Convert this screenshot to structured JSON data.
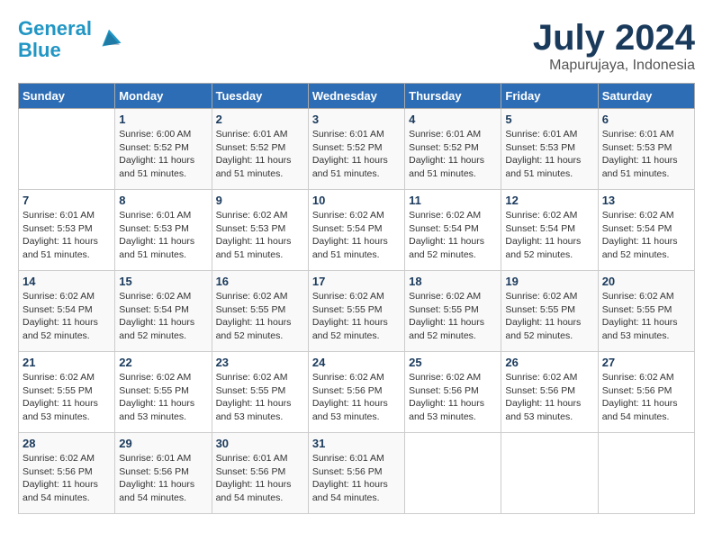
{
  "header": {
    "logo_line1": "General",
    "logo_line2": "Blue",
    "month_year": "July 2024",
    "location": "Mapurujaya, Indonesia"
  },
  "weekdays": [
    "Sunday",
    "Monday",
    "Tuesday",
    "Wednesday",
    "Thursday",
    "Friday",
    "Saturday"
  ],
  "weeks": [
    [
      {
        "day": "",
        "info": ""
      },
      {
        "day": "1",
        "info": "Sunrise: 6:00 AM\nSunset: 5:52 PM\nDaylight: 11 hours\nand 51 minutes."
      },
      {
        "day": "2",
        "info": "Sunrise: 6:01 AM\nSunset: 5:52 PM\nDaylight: 11 hours\nand 51 minutes."
      },
      {
        "day": "3",
        "info": "Sunrise: 6:01 AM\nSunset: 5:52 PM\nDaylight: 11 hours\nand 51 minutes."
      },
      {
        "day": "4",
        "info": "Sunrise: 6:01 AM\nSunset: 5:52 PM\nDaylight: 11 hours\nand 51 minutes."
      },
      {
        "day": "5",
        "info": "Sunrise: 6:01 AM\nSunset: 5:53 PM\nDaylight: 11 hours\nand 51 minutes."
      },
      {
        "day": "6",
        "info": "Sunrise: 6:01 AM\nSunset: 5:53 PM\nDaylight: 11 hours\nand 51 minutes."
      }
    ],
    [
      {
        "day": "7",
        "info": "Sunrise: 6:01 AM\nSunset: 5:53 PM\nDaylight: 11 hours\nand 51 minutes."
      },
      {
        "day": "8",
        "info": "Sunrise: 6:01 AM\nSunset: 5:53 PM\nDaylight: 11 hours\nand 51 minutes."
      },
      {
        "day": "9",
        "info": "Sunrise: 6:02 AM\nSunset: 5:53 PM\nDaylight: 11 hours\nand 51 minutes."
      },
      {
        "day": "10",
        "info": "Sunrise: 6:02 AM\nSunset: 5:54 PM\nDaylight: 11 hours\nand 51 minutes."
      },
      {
        "day": "11",
        "info": "Sunrise: 6:02 AM\nSunset: 5:54 PM\nDaylight: 11 hours\nand 52 minutes."
      },
      {
        "day": "12",
        "info": "Sunrise: 6:02 AM\nSunset: 5:54 PM\nDaylight: 11 hours\nand 52 minutes."
      },
      {
        "day": "13",
        "info": "Sunrise: 6:02 AM\nSunset: 5:54 PM\nDaylight: 11 hours\nand 52 minutes."
      }
    ],
    [
      {
        "day": "14",
        "info": "Sunrise: 6:02 AM\nSunset: 5:54 PM\nDaylight: 11 hours\nand 52 minutes."
      },
      {
        "day": "15",
        "info": "Sunrise: 6:02 AM\nSunset: 5:54 PM\nDaylight: 11 hours\nand 52 minutes."
      },
      {
        "day": "16",
        "info": "Sunrise: 6:02 AM\nSunset: 5:55 PM\nDaylight: 11 hours\nand 52 minutes."
      },
      {
        "day": "17",
        "info": "Sunrise: 6:02 AM\nSunset: 5:55 PM\nDaylight: 11 hours\nand 52 minutes."
      },
      {
        "day": "18",
        "info": "Sunrise: 6:02 AM\nSunset: 5:55 PM\nDaylight: 11 hours\nand 52 minutes."
      },
      {
        "day": "19",
        "info": "Sunrise: 6:02 AM\nSunset: 5:55 PM\nDaylight: 11 hours\nand 52 minutes."
      },
      {
        "day": "20",
        "info": "Sunrise: 6:02 AM\nSunset: 5:55 PM\nDaylight: 11 hours\nand 53 minutes."
      }
    ],
    [
      {
        "day": "21",
        "info": "Sunrise: 6:02 AM\nSunset: 5:55 PM\nDaylight: 11 hours\nand 53 minutes."
      },
      {
        "day": "22",
        "info": "Sunrise: 6:02 AM\nSunset: 5:55 PM\nDaylight: 11 hours\nand 53 minutes."
      },
      {
        "day": "23",
        "info": "Sunrise: 6:02 AM\nSunset: 5:55 PM\nDaylight: 11 hours\nand 53 minutes."
      },
      {
        "day": "24",
        "info": "Sunrise: 6:02 AM\nSunset: 5:56 PM\nDaylight: 11 hours\nand 53 minutes."
      },
      {
        "day": "25",
        "info": "Sunrise: 6:02 AM\nSunset: 5:56 PM\nDaylight: 11 hours\nand 53 minutes."
      },
      {
        "day": "26",
        "info": "Sunrise: 6:02 AM\nSunset: 5:56 PM\nDaylight: 11 hours\nand 53 minutes."
      },
      {
        "day": "27",
        "info": "Sunrise: 6:02 AM\nSunset: 5:56 PM\nDaylight: 11 hours\nand 54 minutes."
      }
    ],
    [
      {
        "day": "28",
        "info": "Sunrise: 6:02 AM\nSunset: 5:56 PM\nDaylight: 11 hours\nand 54 minutes."
      },
      {
        "day": "29",
        "info": "Sunrise: 6:01 AM\nSunset: 5:56 PM\nDaylight: 11 hours\nand 54 minutes."
      },
      {
        "day": "30",
        "info": "Sunrise: 6:01 AM\nSunset: 5:56 PM\nDaylight: 11 hours\nand 54 minutes."
      },
      {
        "day": "31",
        "info": "Sunrise: 6:01 AM\nSunset: 5:56 PM\nDaylight: 11 hours\nand 54 minutes."
      },
      {
        "day": "",
        "info": ""
      },
      {
        "day": "",
        "info": ""
      },
      {
        "day": "",
        "info": ""
      }
    ]
  ]
}
